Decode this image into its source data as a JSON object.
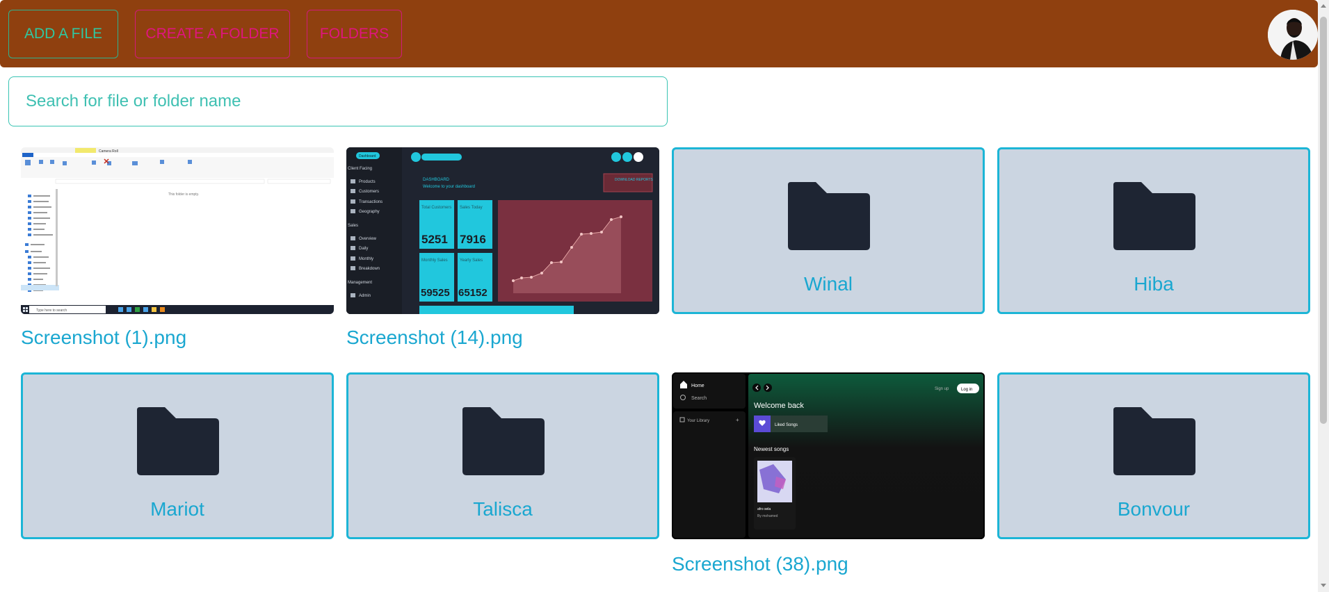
{
  "toolbar": {
    "add_file_label": "ADD A FILE",
    "create_folder_label": "CREATE A FOLDER",
    "folders_label": "FOLDERS"
  },
  "search": {
    "placeholder": "Search for file or folder name",
    "value": ""
  },
  "items": [
    {
      "type": "file",
      "name": "Screenshot (1).png",
      "thumbnail": "file-explorer-screenshot"
    },
    {
      "type": "file",
      "name": "Screenshot (14).png",
      "thumbnail": "dashboard-screenshot"
    },
    {
      "type": "folder",
      "name": "Winal",
      "icon": "folder-icon"
    },
    {
      "type": "folder",
      "name": "Hiba",
      "icon": "folder-icon"
    },
    {
      "type": "folder",
      "name": "Mariot",
      "icon": "folder-icon"
    },
    {
      "type": "folder",
      "name": "Talisca",
      "icon": "folder-icon"
    },
    {
      "type": "file",
      "name": "Screenshot (38).png",
      "thumbnail": "music-app-screenshot"
    },
    {
      "type": "folder",
      "name": "Bonvour",
      "icon": "folder-icon"
    }
  ],
  "thumbnails": {
    "explorer": {
      "window_title": "Camera Roll",
      "empty_text": "This folder is empty.",
      "taskbar_search": "Type here to search"
    },
    "dashboard": {
      "nav_active": "Dashboard",
      "section_client": "Client Facing",
      "nav_items": [
        "Products",
        "Customers",
        "Transactions",
        "Geography"
      ],
      "section_sales": "Sales",
      "sales_items": [
        "Overview",
        "Daily",
        "Monthly",
        "Breakdown"
      ],
      "section_management": "Management",
      "management_items": [
        "Admin"
      ],
      "heading": "DASHBOARD",
      "subheading": "Welcome to your dashboard",
      "download_label": "DOWNLOAD REPORTS",
      "stats": [
        {
          "label": "Total Customers",
          "value": "5251"
        },
        {
          "label": "Sales Today",
          "value": "7916"
        },
        {
          "label": "Monthly Sales",
          "value": "59525"
        },
        {
          "label": "Yearly Sales",
          "value": "65152"
        }
      ]
    },
    "music": {
      "home": "Home",
      "search": "Search",
      "library": "Your Library",
      "signup": "Sign up",
      "login": "Log in",
      "welcome": "Welcome back",
      "liked": "Liked Songs",
      "newest": "Newest songs",
      "song_title": "afro sela",
      "song_artist": "By mohamed"
    }
  },
  "colors": {
    "topbar": "#8f400f",
    "accent_green": "#30c7a0",
    "accent_pink": "#e0157f",
    "card_border": "#1cb5d6",
    "card_fill": "#cbd5e1",
    "folder_icon": "#1e2533",
    "label": "#1aa7d0"
  }
}
